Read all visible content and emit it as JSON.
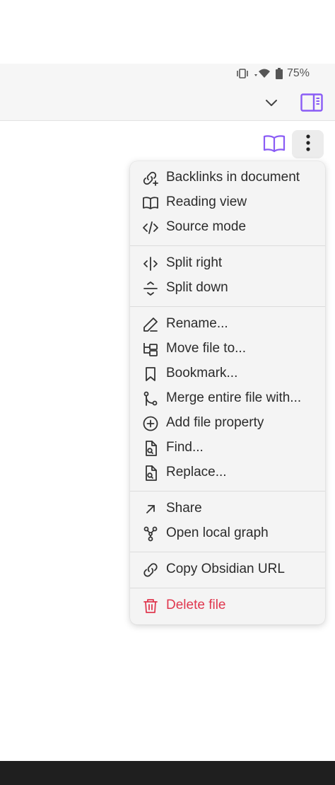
{
  "status_bar": {
    "battery": "75%"
  },
  "menu": {
    "items": [
      {
        "label": "Backlinks in document",
        "icon": "backlinks-icon"
      },
      {
        "label": "Reading view",
        "icon": "book-open-icon"
      },
      {
        "label": "Source mode",
        "icon": "code-icon"
      },
      {
        "label": "Split right",
        "icon": "split-right-icon"
      },
      {
        "label": "Split down",
        "icon": "split-down-icon"
      },
      {
        "label": "Rename...",
        "icon": "pencil-icon"
      },
      {
        "label": "Move file to...",
        "icon": "folder-tree-icon"
      },
      {
        "label": "Bookmark...",
        "icon": "bookmark-icon"
      },
      {
        "label": "Merge entire file with...",
        "icon": "git-merge-icon"
      },
      {
        "label": "Add file property",
        "icon": "plus-circle-icon"
      },
      {
        "label": "Find...",
        "icon": "file-search-icon"
      },
      {
        "label": "Replace...",
        "icon": "file-replace-icon"
      },
      {
        "label": "Share",
        "icon": "arrow-up-right-icon"
      },
      {
        "label": "Open local graph",
        "icon": "graph-icon"
      },
      {
        "label": "Copy Obsidian URL",
        "icon": "link-icon"
      },
      {
        "label": "Delete file",
        "icon": "trash-icon"
      }
    ]
  },
  "colors": {
    "accent": "#8a5cf5",
    "danger": "#e0384f",
    "menu_bg": "#f4f4f4"
  }
}
